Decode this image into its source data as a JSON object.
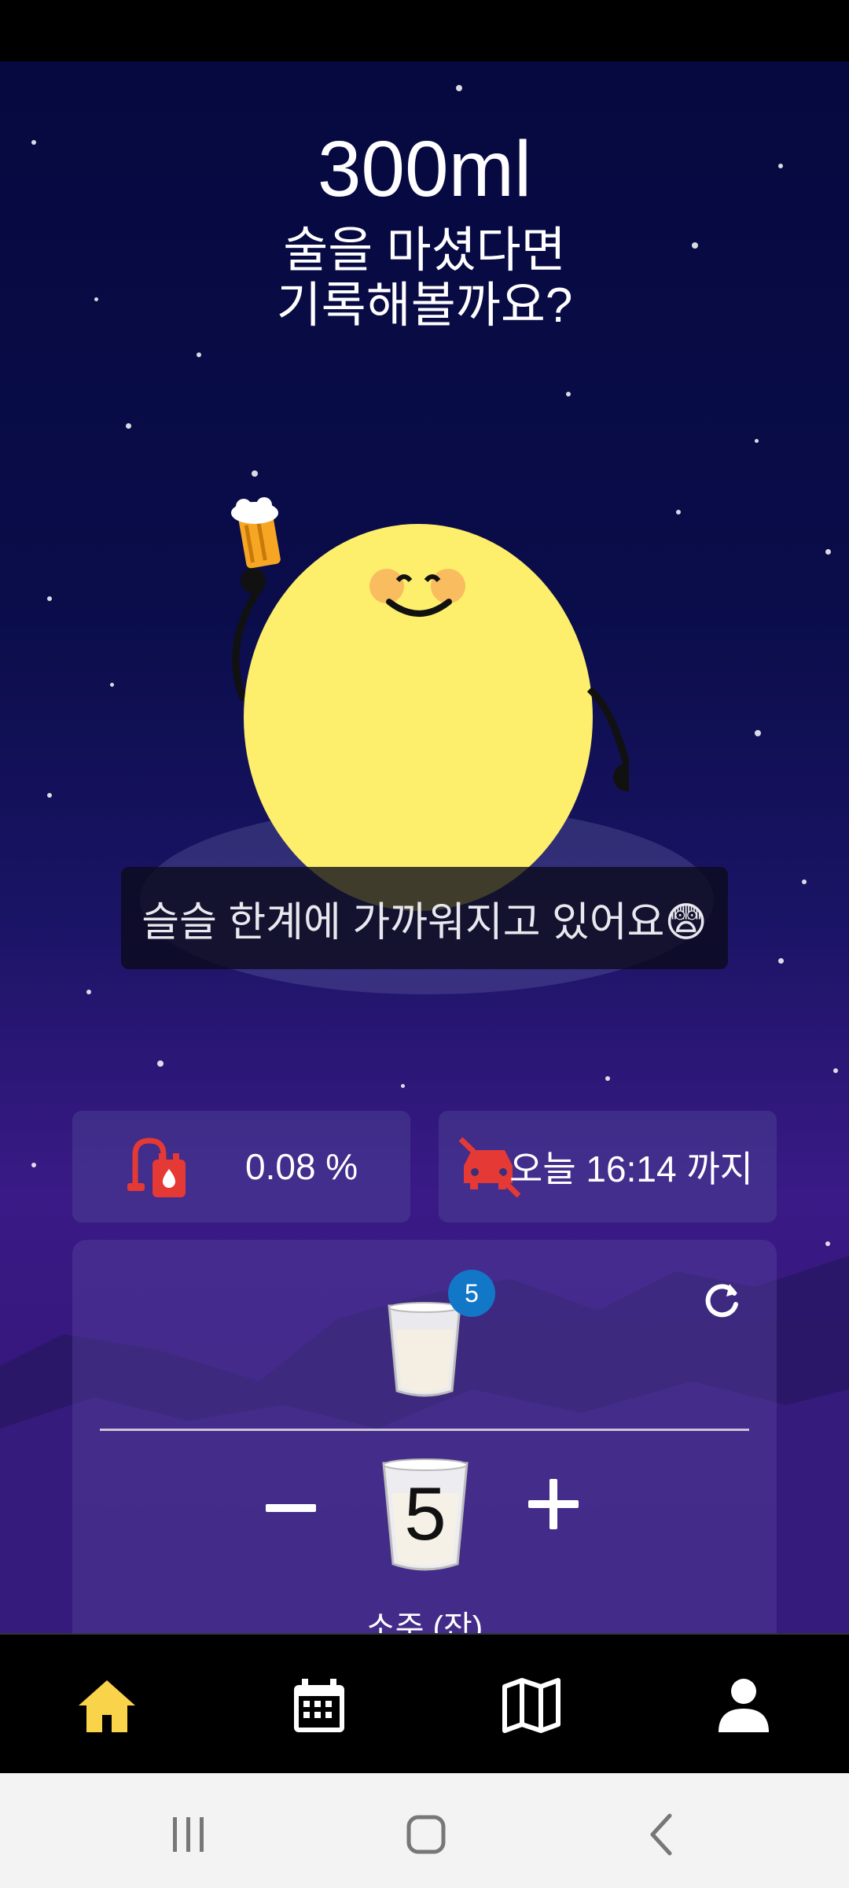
{
  "header": {
    "amount": "300ml",
    "headline": "술을 마셨다면\n기록해볼까요?"
  },
  "character": {
    "message": "슬슬 한계에 가까워지고 있어요😨"
  },
  "stats": {
    "bac_value": "0.08 %",
    "drive_until": "오늘 16:14 까지"
  },
  "counter": {
    "badge": "5",
    "count": "5",
    "unit_label": "소주 (잔)"
  },
  "bottom_nav": {
    "items": [
      "home",
      "calendar",
      "map",
      "profile"
    ],
    "active": "home",
    "active_color": "#f9d44a"
  },
  "colors": {
    "accent": "#f9d44a",
    "moon": "#fdee6b",
    "badge": "#1377c7",
    "warning_icon": "#e53935"
  }
}
